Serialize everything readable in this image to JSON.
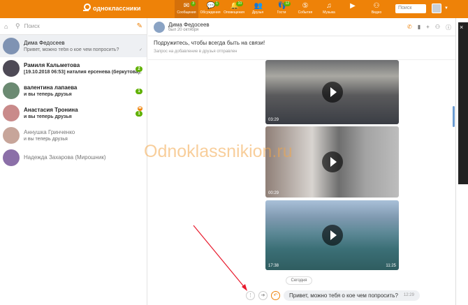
{
  "topbar": {
    "logo": "одноклассники",
    "nav": [
      {
        "label": "Сообщения",
        "icon": "envelope-icon",
        "count": "3",
        "active": true
      },
      {
        "label": "Обсуждения",
        "icon": "discussion-icon",
        "count": "1"
      },
      {
        "label": "Оповещения",
        "icon": "bell-icon",
        "count": "10"
      },
      {
        "label": "Друзья",
        "icon": "friends-icon",
        "count": ""
      },
      {
        "label": "Гости",
        "icon": "guests-icon",
        "count": "12"
      },
      {
        "label": "События",
        "icon": "events-icon",
        "count": ""
      },
      {
        "label": "Музыка",
        "icon": "music-icon",
        "count": ""
      },
      {
        "label": "",
        "icon": "video-icon",
        "count": ""
      },
      {
        "label": "Видео",
        "icon": "binoculars-icon",
        "count": ""
      }
    ],
    "search_placeholder": "Поиск"
  },
  "sidebar": {
    "search_placeholder": "Поиск",
    "chats": [
      {
        "name": "Дима Федосеев",
        "message": "Привет, можно тебя о кое чем попросить?",
        "badge": "",
        "active": true,
        "bold": false,
        "avatar_color": "#7f93b3"
      },
      {
        "name": "Рамиля Кальметова",
        "message": "[19.10.2018 06:53] наталия ерсенева (беркутова):",
        "badge": "2",
        "bold": true,
        "avatar_color": "#4e4a56"
      },
      {
        "name": "валентина лапаева",
        "message": "и вы теперь друзья",
        "badge": "1",
        "bold": true,
        "avatar_color": "#6b8a72"
      },
      {
        "name": "Анастасия Тронина",
        "message": "и вы теперь друзья",
        "badge": "1",
        "bold": true,
        "avatar_color": "#c98a8a"
      },
      {
        "name": "Аннушка Гринченко",
        "message": "и вы теперь друзья",
        "badge": "",
        "bold": false,
        "avatar_color": "#c7a59a"
      },
      {
        "name": "Надежда Захарова (Мирошник)",
        "message": "",
        "badge": "",
        "bold": false,
        "avatar_color": "#8b6fa8"
      }
    ]
  },
  "chat": {
    "name": "Дима Федосеев",
    "seen": "был 20 октября",
    "invite_text": "Подружитесь, чтобы всегда быть на связи!",
    "invite_sub": "Запрос на добавление в друзья отправлен",
    "videos": [
      {
        "duration": "03:29",
        "time": ""
      },
      {
        "duration": "00:29",
        "time": ""
      },
      {
        "duration": "17:38",
        "time": "11:25"
      }
    ],
    "date_chip": "Сегодня",
    "message": "Привет, можно тебя о кое чем попросить?",
    "message_time": "12:29"
  },
  "watermark": "Odnoklassnikion.ru",
  "colors": {
    "brand": "#ee8208",
    "badge": "#5fb000"
  }
}
